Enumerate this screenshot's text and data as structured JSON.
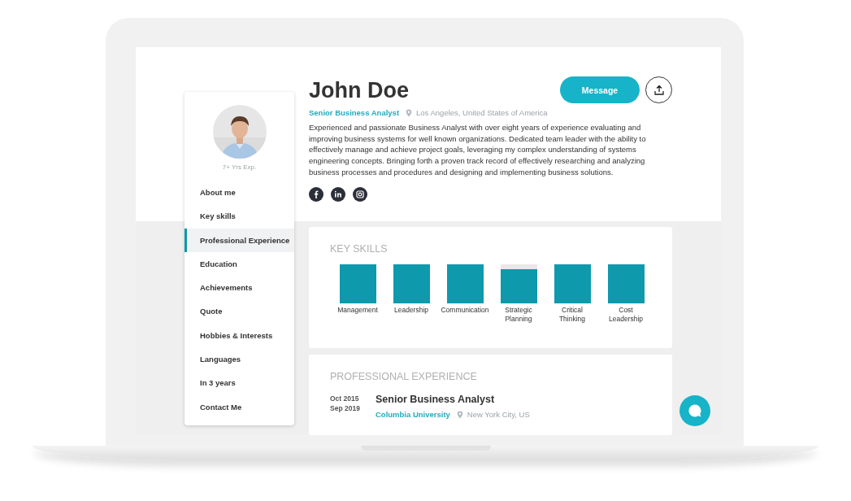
{
  "profile": {
    "name": "John Doe",
    "title": "Senior Business Analyst",
    "location": "Los Angeles, United States of America",
    "experience": "7+ Yrs Exp.",
    "summary": "Experienced and passionate Business Analyst with over eight years of experience evaluating and improving business systems for well known organizations. Dedicated team leader with the ability to effectively manage and achieve project goals, leveraging my complex understanding of systems engineering concepts. Bringing forth a proven track record of effectively researching and analyzing business processes and procedures and designing and implementing business solutions."
  },
  "actions": {
    "message": "Message"
  },
  "social": [
    {
      "kind": "facebook"
    },
    {
      "kind": "linkedin"
    },
    {
      "kind": "instagram"
    }
  ],
  "sidebar": {
    "items": [
      {
        "label": "About me",
        "selected": false
      },
      {
        "label": "Key skills",
        "selected": false
      },
      {
        "label": "Professional Experience",
        "selected": true
      },
      {
        "label": "Education",
        "selected": false
      },
      {
        "label": "Achievements",
        "selected": false
      },
      {
        "label": "Quote",
        "selected": false
      },
      {
        "label": "Hobbies & Interests",
        "selected": false
      },
      {
        "label": "Languages",
        "selected": false
      },
      {
        "label": "In 3 years",
        "selected": false
      },
      {
        "label": "Contact Me",
        "selected": false
      }
    ]
  },
  "key_skills": {
    "heading": "KEY SKILLS",
    "skills": [
      {
        "label": "Management",
        "level": 1
      },
      {
        "label": "Leadership",
        "level": 1
      },
      {
        "label": "Communication",
        "level": 1
      },
      {
        "label": "Strategic Planning",
        "level": 0.88
      },
      {
        "label": "Critical Thinking",
        "level": 1
      },
      {
        "label": "Cost Leadership",
        "level": 1
      }
    ]
  },
  "experience": {
    "heading": "PROFESSIONAL EXPERIENCE",
    "entries": [
      {
        "start": "Oct 2015",
        "end": "Sep 2019",
        "role": "Senior Business Analyst",
        "company": "Columbia University",
        "location": "New York City, US"
      }
    ]
  }
}
